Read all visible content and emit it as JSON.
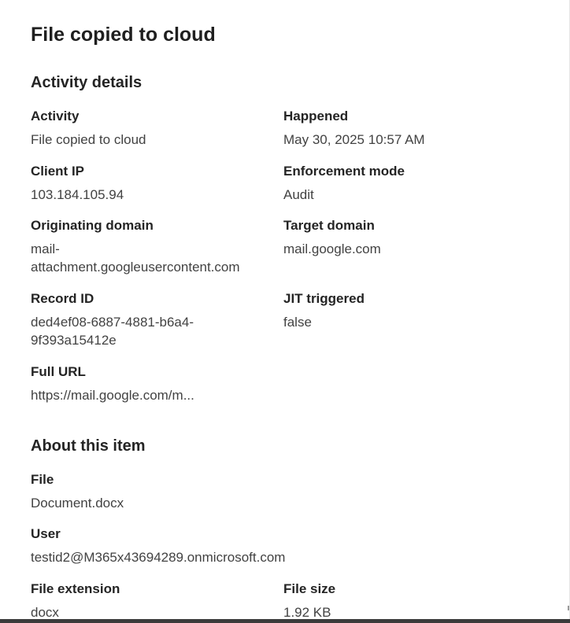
{
  "panel": {
    "title": "File copied to cloud"
  },
  "activity_details": {
    "heading": "Activity details",
    "activity": {
      "label": "Activity",
      "value": "File copied to cloud"
    },
    "happened": {
      "label": "Happened",
      "value": "May 30, 2025 10:57 AM"
    },
    "client_ip": {
      "label": "Client IP",
      "value": "103.184.105.94"
    },
    "enforcement_mode": {
      "label": "Enforcement mode",
      "value": "Audit"
    },
    "originating_domain": {
      "label": "Originating domain",
      "value": "mail-attachment.googleusercontent.com"
    },
    "target_domain": {
      "label": "Target domain",
      "value": "mail.google.com"
    },
    "record_id": {
      "label": "Record ID",
      "value": "ded4ef08-6887-4881-b6a4-9f393a15412e"
    },
    "jit_triggered": {
      "label": "JIT triggered",
      "value": "false"
    },
    "full_url": {
      "label": "Full URL",
      "value": "https://mail.google.com/m..."
    }
  },
  "about_item": {
    "heading": "About this item",
    "file": {
      "label": "File",
      "value": "Document.docx"
    },
    "user": {
      "label": "User",
      "value": "testid2@M365x43694289.onmicrosoft.com"
    },
    "file_extension": {
      "label": "File extension",
      "value": "docx"
    },
    "file_size": {
      "label": "File size",
      "value": "1.92 KB"
    }
  }
}
